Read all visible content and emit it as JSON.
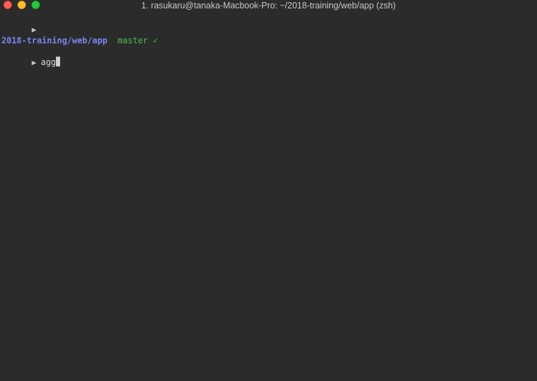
{
  "window": {
    "title": "1. rasukaru@tanaka-Macbook-Pro: ~/2018-training/web/app (zsh)"
  },
  "terminal": {
    "prompt_symbol": "▶",
    "path": "2018-training/web/app",
    "branch": "master",
    "status_mark": "✓",
    "input": "agg"
  }
}
